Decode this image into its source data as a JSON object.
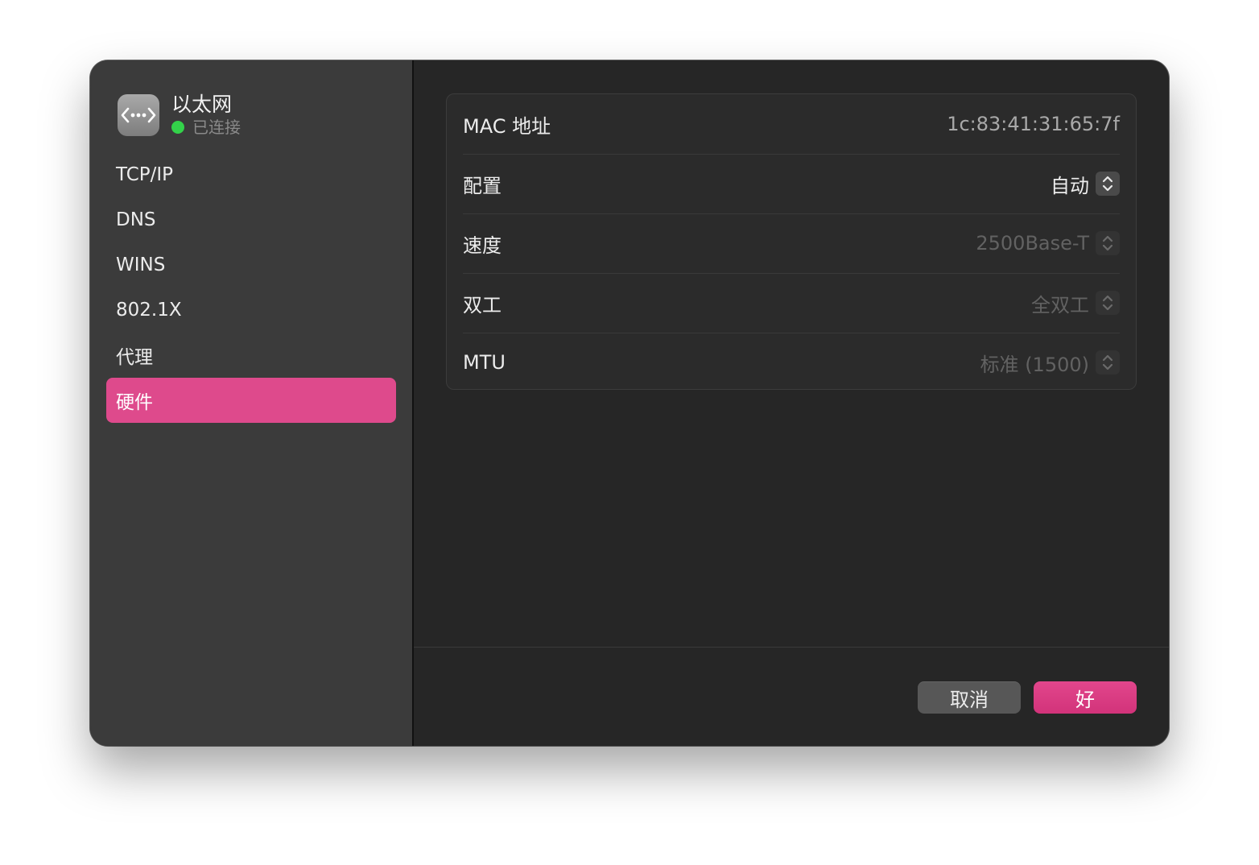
{
  "sidebar": {
    "title": "以太网",
    "status": "已连接",
    "status_color": "#33d24a",
    "icon": "ethernet-icon",
    "items": [
      {
        "label": "TCP/IP",
        "active": false
      },
      {
        "label": "DNS",
        "active": false
      },
      {
        "label": "WINS",
        "active": false
      },
      {
        "label": "802.1X",
        "active": false
      },
      {
        "label": "代理",
        "active": false
      },
      {
        "label": "硬件",
        "active": true
      }
    ]
  },
  "hardware": {
    "mac": {
      "label": "MAC 地址",
      "value": "1c:83:41:31:65:7f"
    },
    "config": {
      "label": "配置",
      "value": "自动"
    },
    "speed": {
      "label": "速度",
      "value": "2500Base-T"
    },
    "duplex": {
      "label": "双工",
      "value": "全双工"
    },
    "mtu": {
      "label": "MTU",
      "value": "标准 (1500)"
    }
  },
  "footer": {
    "cancel_label": "取消",
    "ok_label": "好"
  },
  "colors": {
    "accent": "#de4a8c",
    "window_bg": "#262626",
    "sidebar_bg": "#3b3b3b"
  }
}
